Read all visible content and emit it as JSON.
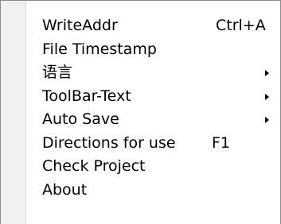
{
  "menu": {
    "items": [
      {
        "label": "WriteAddr",
        "shortcut": "Ctrl+A"
      },
      {
        "label": "File Timestamp"
      },
      {
        "label": "语言"
      },
      {
        "label": "ToolBar-Text"
      },
      {
        "label": "Auto Save"
      },
      {
        "label": "Directions for use",
        "shortcut": "F1"
      },
      {
        "label": "Check Project"
      },
      {
        "label": "About"
      }
    ]
  },
  "icons": {
    "submenu_arrow": "submenu-arrow-icon"
  }
}
